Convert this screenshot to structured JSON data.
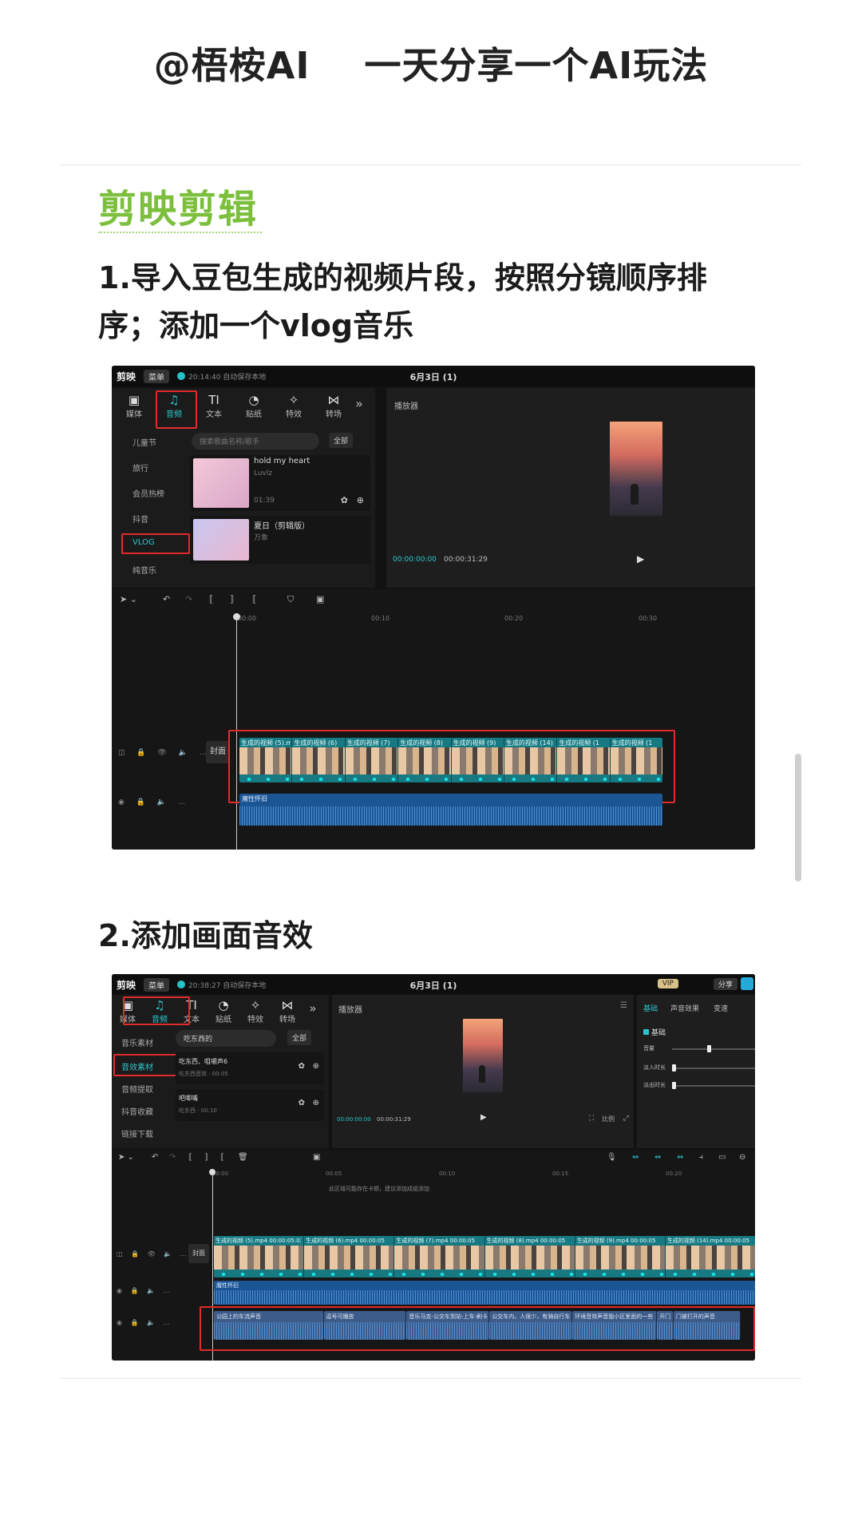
{
  "header": {
    "title": "@梧桉AI    一天分享一个AI玩法"
  },
  "section": {
    "title": "剪映剪辑"
  },
  "steps": [
    {
      "line1": "1.导入豆包生成的视频片段，按照分镜顺序排",
      "line2": "序；添加一个vlog音乐"
    },
    {
      "line1": "2.添加画面音效"
    }
  ],
  "shot1": {
    "app_name": "剪映",
    "menu": "菜单",
    "autosave": "20:14:40 自动保存本地",
    "project": "6月3日 (1)",
    "tools": [
      {
        "icon": "▣",
        "label": "媒体"
      },
      {
        "icon": "♫",
        "label": "音频"
      },
      {
        "icon": "TI",
        "label": "文本"
      },
      {
        "icon": "◔",
        "label": "贴纸"
      },
      {
        "icon": "✧",
        "label": "特效"
      },
      {
        "icon": "⋈",
        "label": "转场"
      }
    ],
    "more": "»",
    "sidebar": [
      "儿童节",
      "旅行",
      "会员热榜",
      "抖音",
      "VLOG",
      "纯音乐"
    ],
    "search_placeholder": "搜索歌曲名称/歌手",
    "all_button": "全部",
    "songs": [
      {
        "title": "hold my heart",
        "artist": "Luvlz",
        "duration": "01:39"
      },
      {
        "title": "夏日（剪辑版）",
        "artist": "万象"
      }
    ],
    "player": {
      "label": "播放器",
      "time_current": "00:00:00:00",
      "time_total": "00:00:31:29",
      "play": "▶"
    },
    "ruler": [
      "00:00",
      "00:10",
      "00:20",
      "00:30"
    ],
    "cover": "封面",
    "clips": [
      "生成的视频 (5).mp4",
      "生成的视频 (6)",
      "生成的视频 (7)",
      "生成的视频 (8)",
      "生成的视频 (9)",
      "生成的视频 (14)",
      "生成的视频 (1",
      "生成的视频 (1"
    ],
    "audio_label": "魔性怀旧"
  },
  "shot2": {
    "app_name": "剪映",
    "menu": "菜单",
    "autosave": "20:38:27 自动保存本地",
    "project": "6月3日 (1)",
    "vip": "VIP",
    "share": "分享",
    "tools": [
      {
        "icon": "▣",
        "label": "媒体"
      },
      {
        "icon": "♫",
        "label": "音频"
      },
      {
        "icon": "TI",
        "label": "文本"
      },
      {
        "icon": "◔",
        "label": "贴纸"
      },
      {
        "icon": "✧",
        "label": "特效"
      },
      {
        "icon": "⋈",
        "label": "转场"
      }
    ],
    "more": "»",
    "sidebar": [
      "音乐素材",
      "音效素材",
      "音频提取",
      "抖音收藏",
      "链接下载"
    ],
    "search_value": "吃东西的",
    "all_button": "全部",
    "sounds": [
      {
        "title": "吃东西、咀嚼声6",
        "sub": "吃东西音效 · 00:05"
      },
      {
        "title": "吧唧嘴",
        "sub": "吃东西 · 00:10"
      }
    ],
    "player": {
      "label": "播放器",
      "time_current": "00:00:00:00",
      "time_total": "00:00:31:29",
      "play": "▶",
      "ratio": "比例"
    },
    "right_panel": {
      "tabs": [
        "基础",
        "声音效果",
        "变速"
      ],
      "section": "基础",
      "rows": [
        "音量",
        "淡入时长",
        "淡出时长"
      ]
    },
    "ruler": [
      "00:00",
      "00:05",
      "00:10",
      "00:15",
      "00:20"
    ],
    "hint": "此区域可能存在卡顿，建议添加成组添加",
    "cover": "封面",
    "clips": [
      "生成的视频 (5).mp4  00:00:05:02",
      "生成的视频 (6).mp4  00:00:05",
      "生成的视频 (7).mp4  00:00:05",
      "生成的视频 (8).mp4  00:00:05",
      "生成的视频 (9).mp4  00:00:05",
      "生成的视频 (14).mp4  00:00:05"
    ],
    "audio_label": "魔性怀旧",
    "sfx": [
      "公园上的车流声音",
      "逗号可播放",
      "音乐马克-公交车到站-上车-刷卡",
      "公交车内，人很少，有骑自行车",
      "环境音效声音独小区里面的一些",
      "开门",
      "门被打开的声音"
    ]
  }
}
